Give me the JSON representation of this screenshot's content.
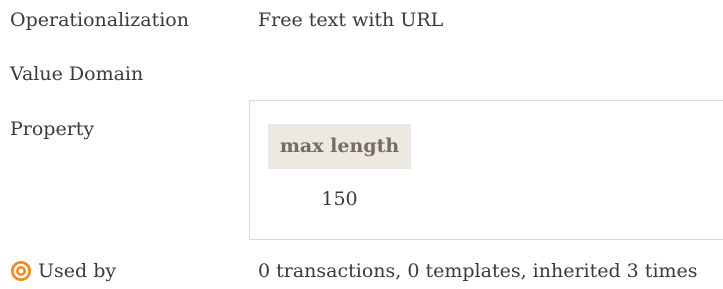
{
  "operationalization": {
    "label": "Operationalization",
    "value": "Free text with URL"
  },
  "value_domain": {
    "label": "Value Domain"
  },
  "property": {
    "label": "Property",
    "header": "max length",
    "value": "150"
  },
  "used_by": {
    "icon": "target-icon",
    "label": "Used by",
    "value": "0 transactions, 0 templates, inherited 3 times"
  },
  "colors": {
    "text": "#3a3a3a",
    "header_bg": "#ede8e1",
    "header_text": "#756c62",
    "border": "#d9d9d9",
    "icon_orange": "#f08a1c"
  }
}
